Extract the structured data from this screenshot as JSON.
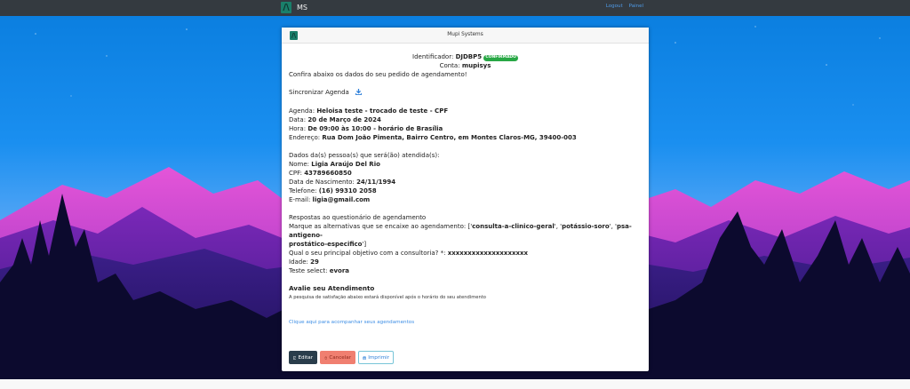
{
  "navbar": {
    "logo_letter": "/\\",
    "brand": "MS",
    "links": [
      "Logout",
      "Painel"
    ]
  },
  "card": {
    "header_title": "Mupi Systems",
    "identifier_label": "Identificador:",
    "identifier_value": "DJDBP5",
    "status_badge": "CONFIRMADO",
    "account_label": "Conta:",
    "account_value": "mupisys",
    "intro": "Confira abaixo os dados do seu pedido de agendamento!",
    "sync_label": "Sincronizar Agenda",
    "booking": {
      "agenda_label": "Agenda:",
      "agenda_value": "Heloisa teste - trocado de teste - CPF",
      "data_label": "Data:",
      "data_value": "20 de Março de 2024",
      "hora_label": "Hora:",
      "hora_value": "De 09:00 às 10:00 - horário de Brasília",
      "endereco_label": "Endereço:",
      "endereco_value": "Rua Dom João Pimenta, Bairro Centro, em Montes Claros-MG, 39400-003"
    },
    "person": {
      "section_title": "Dados da(s) pessoa(s) que será(ão) atendida(s):",
      "nome_label": "Nome:",
      "nome_value": "Ligia Araújo Del Rio",
      "cpf_label": "CPF:",
      "cpf_value": "43789660850",
      "nasc_label": "Data de Nascimento:",
      "nasc_value": "24/11/1994",
      "tel_label": "Telefone:",
      "tel_value": "(16) 99310 2058",
      "email_label": "E-mail:",
      "email_value": "ligia@gmail.com"
    },
    "questionnaire": {
      "section_title": "Respostas ao questionário de agendamento",
      "q1_label": "Marque as alternativas que se encaixe ao agendamento:",
      "q1_value_open": "['",
      "q1_opt1": "consulta-a-clinico-geral",
      "q1_sep": "', '",
      "q1_opt2": "potássio-soro",
      "q1_opt3": "psa-antigeno-",
      "q1_opt3b": "prostático-especifico",
      "q1_value_close": "']",
      "q2_label": "Qual o seu principal objetivo com a consultoria? *:",
      "q2_value": "xxxxxxxxxxxxxxxxxxxx",
      "idade_label": "Idade:",
      "idade_value": "29",
      "select_label": "Teste select:",
      "select_value": "evora"
    },
    "rating": {
      "title": "Avalie seu Atendimento",
      "note": "A pesquisa de satisfação abaixo estará disponível após o horário do seu atendimento"
    },
    "track_link": "Clique aqui para acompanhar seus agendamentos",
    "buttons": {
      "edit": "Editar",
      "cancel": "Cancelar",
      "print": "Imprimir"
    }
  },
  "colors": {
    "navbar": "#343a40",
    "accent_teal": "#1a7f6a",
    "badge_green": "#28a745",
    "link_blue": "#3d8ee5",
    "edit_button": "#2a3d4b",
    "cancel_button": "#f07f70"
  },
  "icons": {
    "sync": "download-icon",
    "edit": "edit-icon",
    "cancel": "trash-icon",
    "print": "print-icon"
  }
}
